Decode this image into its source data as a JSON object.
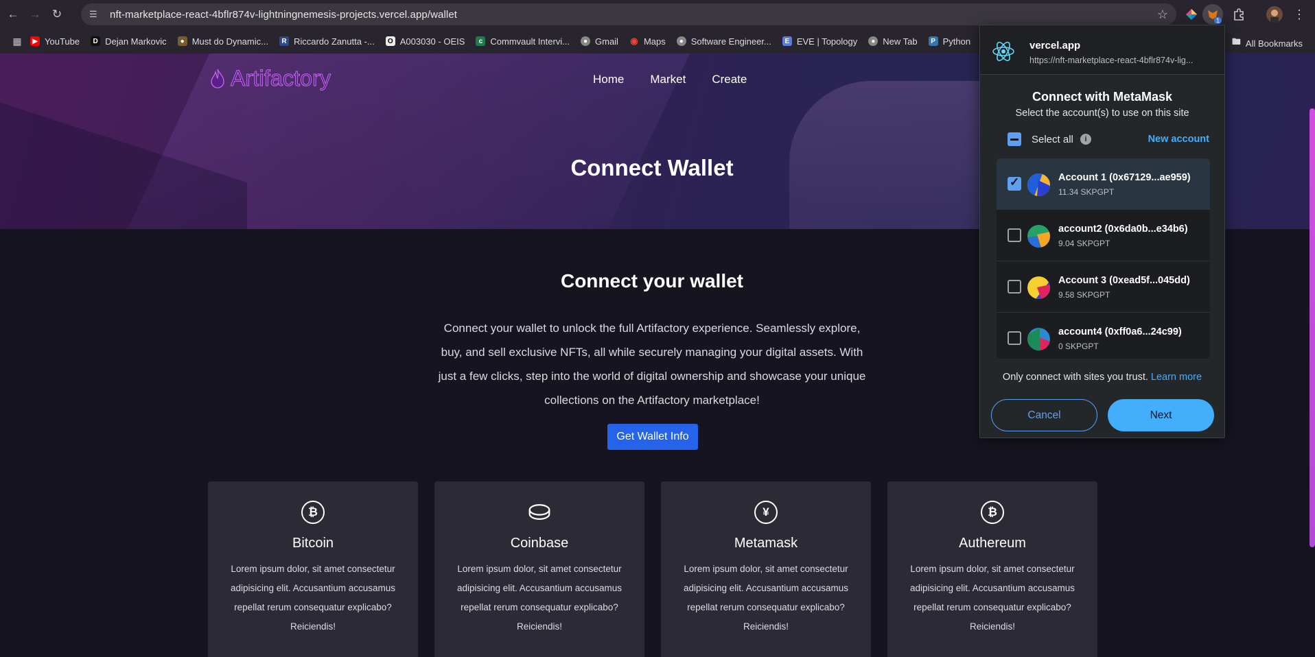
{
  "browser": {
    "url": "nft-marketplace-react-4bflr874v-lightningnemesis-projects.vercel.app/wallet",
    "bookmarks": [
      "YouTube",
      "Dejan Markovic",
      "Must do Dynamic...",
      "Riccardo Zanutta -...",
      "A003030 - OEIS",
      "Commvault Intervi...",
      "Gmail",
      "Maps",
      "Software Engineer...",
      "EVE | Topology",
      "New Tab",
      "Python"
    ],
    "all_bookmarks": "All Bookmarks",
    "extension_badge": "1"
  },
  "site": {
    "logo": "Artifactory",
    "nav": [
      "Home",
      "Market",
      "Create"
    ],
    "hero_title": "Connect Wallet",
    "section_title": "Connect your wallet",
    "lead": "Connect your wallet to unlock the full Artifactory experience. Seamlessly explore, buy, and sell exclusive NFTs, all while securely managing your digital assets. With just a few clicks, step into the world of digital ownership and showcase your unique collections on the Artifactory marketplace!",
    "cta": "Get Wallet Info",
    "cards": [
      {
        "title": "Bitcoin",
        "icon": "bitcoin-icon",
        "text": "Lorem ipsum dolor, sit amet consectetur adipisicing elit. Accusantium accusamus repellat rerum consequatur explicabo? Reiciendis!"
      },
      {
        "title": "Coinbase",
        "icon": "coin-icon",
        "text": "Lorem ipsum dolor, sit amet consectetur adipisicing elit. Accusantium accusamus repellat rerum consequatur explicabo? Reiciendis!"
      },
      {
        "title": "Metamask",
        "icon": "yen-icon",
        "text": "Lorem ipsum dolor, sit amet consectetur adipisicing elit. Accusantium accusamus repellat rerum consequatur explicabo? Reiciendis!"
      },
      {
        "title": "Authereum",
        "icon": "bitcoin-icon",
        "text": "Lorem ipsum dolor, sit amet consectetur adipisicing elit. Accusantium accusamus repellat rerum consequatur explicabo? Reiciendis!"
      }
    ]
  },
  "metamask": {
    "site_name": "vercel.app",
    "site_url": "https://nft-marketplace-react-4bflr874v-lig...",
    "title": "Connect with MetaMask",
    "subtitle": "Select the account(s) to use on this site",
    "select_all": "Select all",
    "new_account": "New account",
    "accounts": [
      {
        "name": "Account 1 (0x67129...ae959)",
        "balance": "11.34 SKPGPT",
        "selected": true
      },
      {
        "name": "account2 (0x6da0b...e34b6)",
        "balance": "9.04 SKPGPT",
        "selected": false
      },
      {
        "name": "Account 3 (0xead5f...045dd)",
        "balance": "9.58 SKPGPT",
        "selected": false
      },
      {
        "name": "account4 (0xff0a6...24c99)",
        "balance": "0 SKPGPT",
        "selected": false
      }
    ],
    "trust_text": "Only connect with sites you trust.",
    "learn_more": "Learn more",
    "cancel": "Cancel",
    "next": "Next"
  },
  "colors": {
    "accent_blue": "#43aefc",
    "cta_blue": "#2563eb",
    "logo_purple": "#c36ae8"
  }
}
